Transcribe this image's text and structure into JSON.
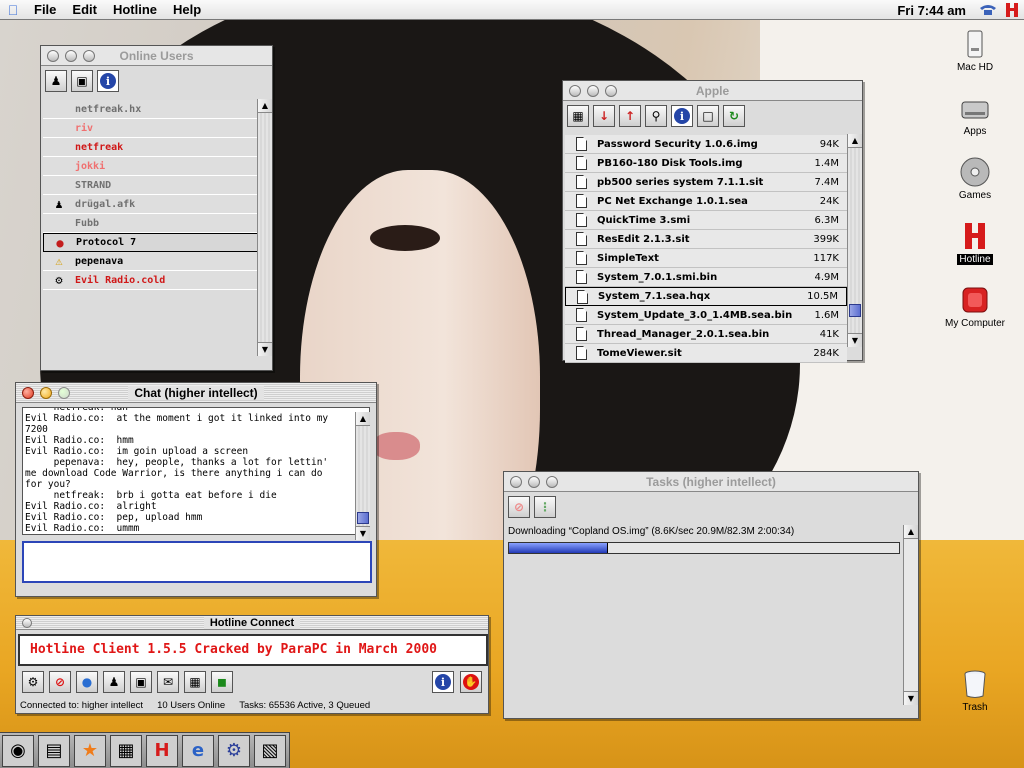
{
  "menubar": {
    "items": [
      "File",
      "Edit",
      "Hotline",
      "Help"
    ],
    "clock": "Fri 7:44 am"
  },
  "users_window": {
    "title": "Online Users",
    "users": [
      {
        "name": "netfreak.hx",
        "color": "#707070",
        "icon": ""
      },
      {
        "name": "riv",
        "color": "#f07070",
        "icon": ""
      },
      {
        "name": "netfreak",
        "color": "#d01818",
        "icon": ""
      },
      {
        "name": "jokki",
        "color": "#f07070",
        "icon": ""
      },
      {
        "name": "STRAND",
        "color": "#707070",
        "icon": ""
      },
      {
        "name": "drügal.afk",
        "color": "#707070",
        "icon": "person-icon"
      },
      {
        "name": "Fubb",
        "color": "#707070",
        "icon": ""
      },
      {
        "name": "Protocol 7",
        "color": "#000000",
        "icon": "globe-icon"
      },
      {
        "name": "pepenava",
        "color": "#000000",
        "icon": "warning-icon"
      },
      {
        "name": "Evil Radio.cold",
        "color": "#d01818",
        "icon": "key-icon"
      }
    ]
  },
  "files_window": {
    "title": "Apple",
    "files": [
      {
        "name": "Password Security 1.0.6.img",
        "size": "94K"
      },
      {
        "name": "PB160-180 Disk Tools.img",
        "size": "1.4M"
      },
      {
        "name": "pb500 series system 7.1.1.sit",
        "size": "7.4M"
      },
      {
        "name": "PC Net Exchange 1.0.1.sea",
        "size": "24K"
      },
      {
        "name": "QuickTime 3.smi",
        "size": "6.3M"
      },
      {
        "name": "ResEdit 2.1.3.sit",
        "size": "399K"
      },
      {
        "name": "SimpleText",
        "size": "117K"
      },
      {
        "name": "System_7.0.1.smi.bin",
        "size": "4.9M"
      },
      {
        "name": "System_7.1.sea.hqx",
        "size": "10.5M"
      },
      {
        "name": "System_Update_3.0_1.4MB.sea.bin",
        "size": "1.6M"
      },
      {
        "name": "Thread_Manager_2.0.1.sea.bin",
        "size": "41K"
      },
      {
        "name": "TomeViewer.sit",
        "size": "284K"
      }
    ]
  },
  "chat_window": {
    "title": "Chat (higher intellect)",
    "lines": [
      "     netfreak: hah",
      "Evil Radio.co:  at the moment i got it linked into my",
      "7200",
      "Evil Radio.co:  hmm",
      "Evil Radio.co:  im goin upload a screen",
      "     pepenava:  hey, people, thanks a lot for lettin'",
      "me download Code Warrior, is there anything i can do",
      "for you?",
      "     netfreak:  brb i gotta eat before i die",
      "Evil Radio.co:  alright",
      "Evil Radio.co:  pep, upload hmm",
      "Evil Radio.co:  ummm"
    ],
    "input_value": ""
  },
  "connect_window": {
    "title": "Hotline Connect",
    "banner": "Hotline Client 1.5.5 Cracked by ParaPC in March 2000",
    "status_connected": "Connected to: higher intellect",
    "status_users": "10 Users Online",
    "status_tasks": "Tasks: 65536 Active, 3 Queued"
  },
  "tasks_window": {
    "title": "Tasks (higher intellect)",
    "task_text": "Downloading “Copland OS.img” (8.6K/sec 20.9M/82.3M 2:00:34)",
    "progress": 0.254
  },
  "desktop": {
    "icons": [
      {
        "label": "Mac HD",
        "icon": "hard-drive-icon"
      },
      {
        "label": "Apps",
        "icon": "hard-drive-icon"
      },
      {
        "label": "Games",
        "icon": "disc-icon"
      },
      {
        "label": "Hotline",
        "icon": "hotline-icon"
      },
      {
        "label": "My Computer",
        "icon": "my-computer-icon"
      },
      {
        "label": "Trash",
        "icon": "trash-icon"
      }
    ]
  }
}
